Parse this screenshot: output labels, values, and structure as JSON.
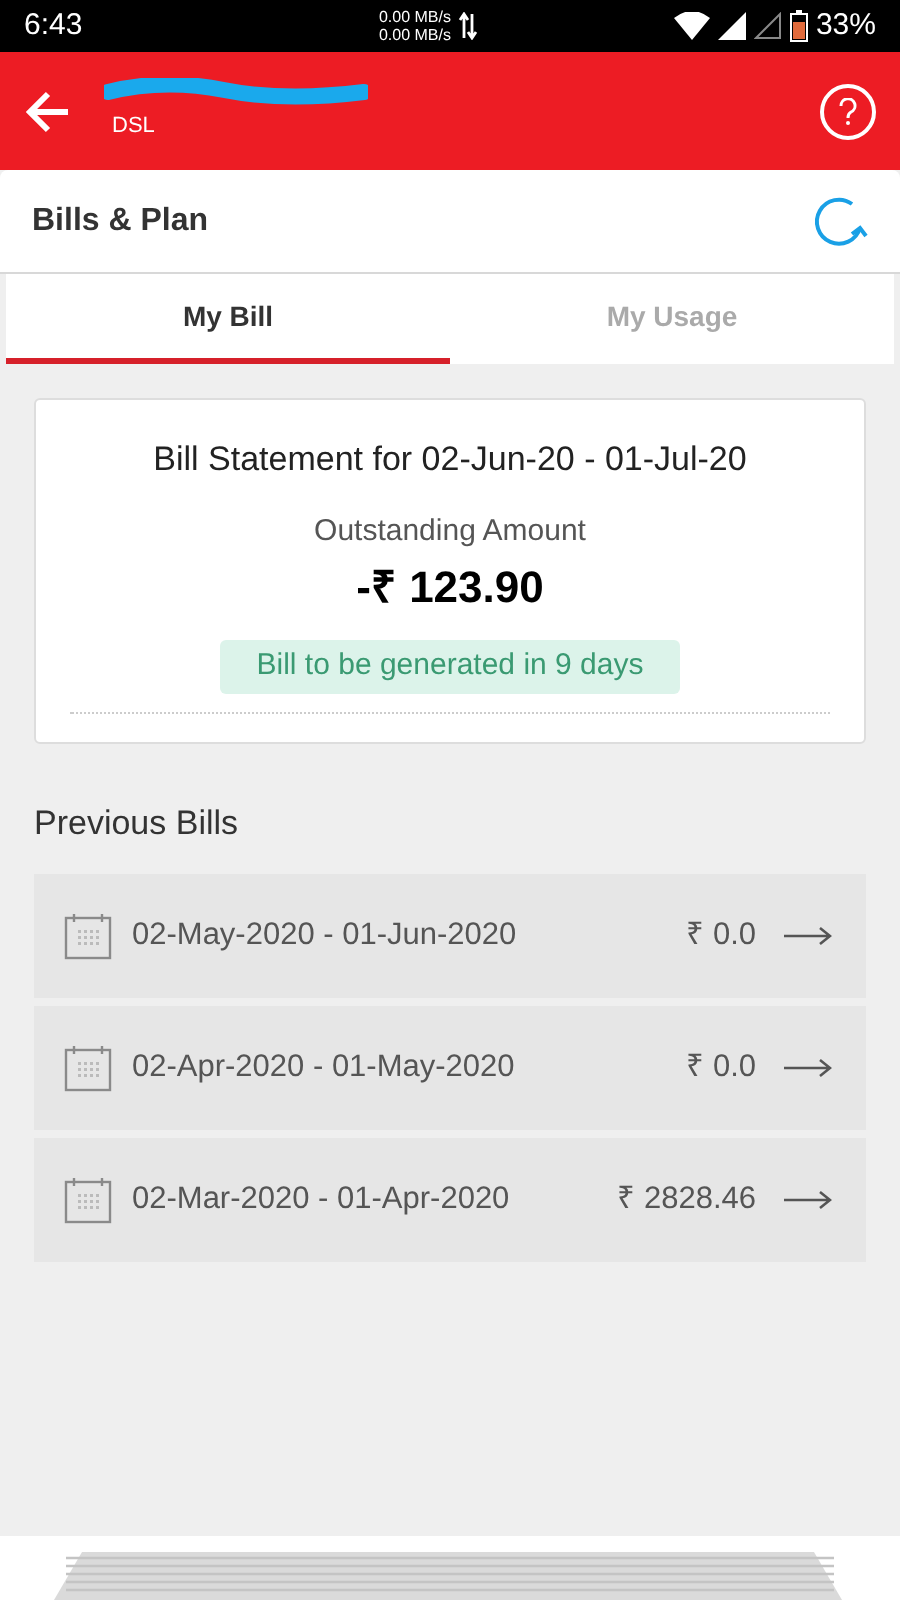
{
  "status_bar": {
    "time": "6:43",
    "speed_up": "0.00 MB/s",
    "speed_down": "0.00 MB/s",
    "battery": "33%"
  },
  "header": {
    "subtitle": "DSL"
  },
  "section": {
    "title": "Bills & Plan"
  },
  "tabs": [
    {
      "label": "My Bill",
      "selected": true
    },
    {
      "label": "My Usage",
      "selected": false
    }
  ],
  "bill_card": {
    "title": "Bill Statement for 02-Jun-20 - 01-Jul-20",
    "amount_label": "Outstanding Amount",
    "amount": "-₹ 123.90",
    "notice": "Bill to be generated in 9 days"
  },
  "previous_bills": {
    "title": "Previous Bills",
    "rows": [
      {
        "period": "02-May-2020 - 01-Jun-2020",
        "amount": "₹ 0.0"
      },
      {
        "period": "02-Apr-2020 - 01-May-2020",
        "amount": "₹ 0.0"
      },
      {
        "period": "02-Mar-2020 - 01-Apr-2020",
        "amount": "₹ 2828.46"
      }
    ]
  }
}
